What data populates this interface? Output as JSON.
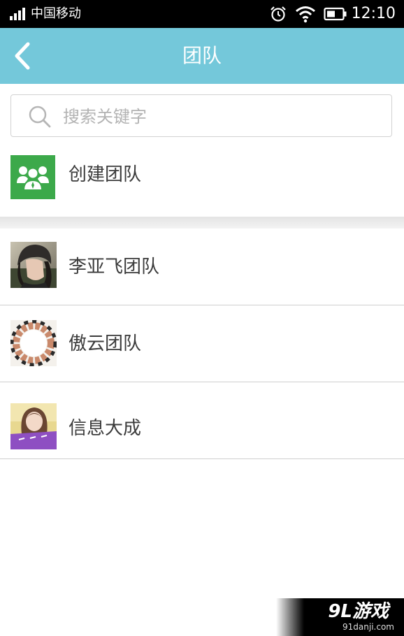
{
  "status_bar": {
    "carrier": "中国移动",
    "time": "12:10"
  },
  "header": {
    "title": "团队",
    "back_icon": "chevron-left-icon"
  },
  "search": {
    "placeholder": "搜索关键字",
    "icon": "search-icon"
  },
  "create_team": {
    "label": "创建团队",
    "icon": "team-group-icon",
    "icon_color": "#3ca94a"
  },
  "teams": [
    {
      "name": "李亚飞团队",
      "avatar": "photo-woman-knit-hat"
    },
    {
      "name": "傲云团队",
      "avatar": "photo-hands-circle"
    },
    {
      "name": "信息大成",
      "avatar": "photo-girl-purple-banner"
    }
  ],
  "watermark": {
    "logo": "9L游戏",
    "url": "91danji.com"
  },
  "colors": {
    "header_bg": "#74c8da",
    "accent_green": "#3ca94a",
    "text_primary": "#3b3b3b",
    "placeholder": "#b3b3b3"
  }
}
